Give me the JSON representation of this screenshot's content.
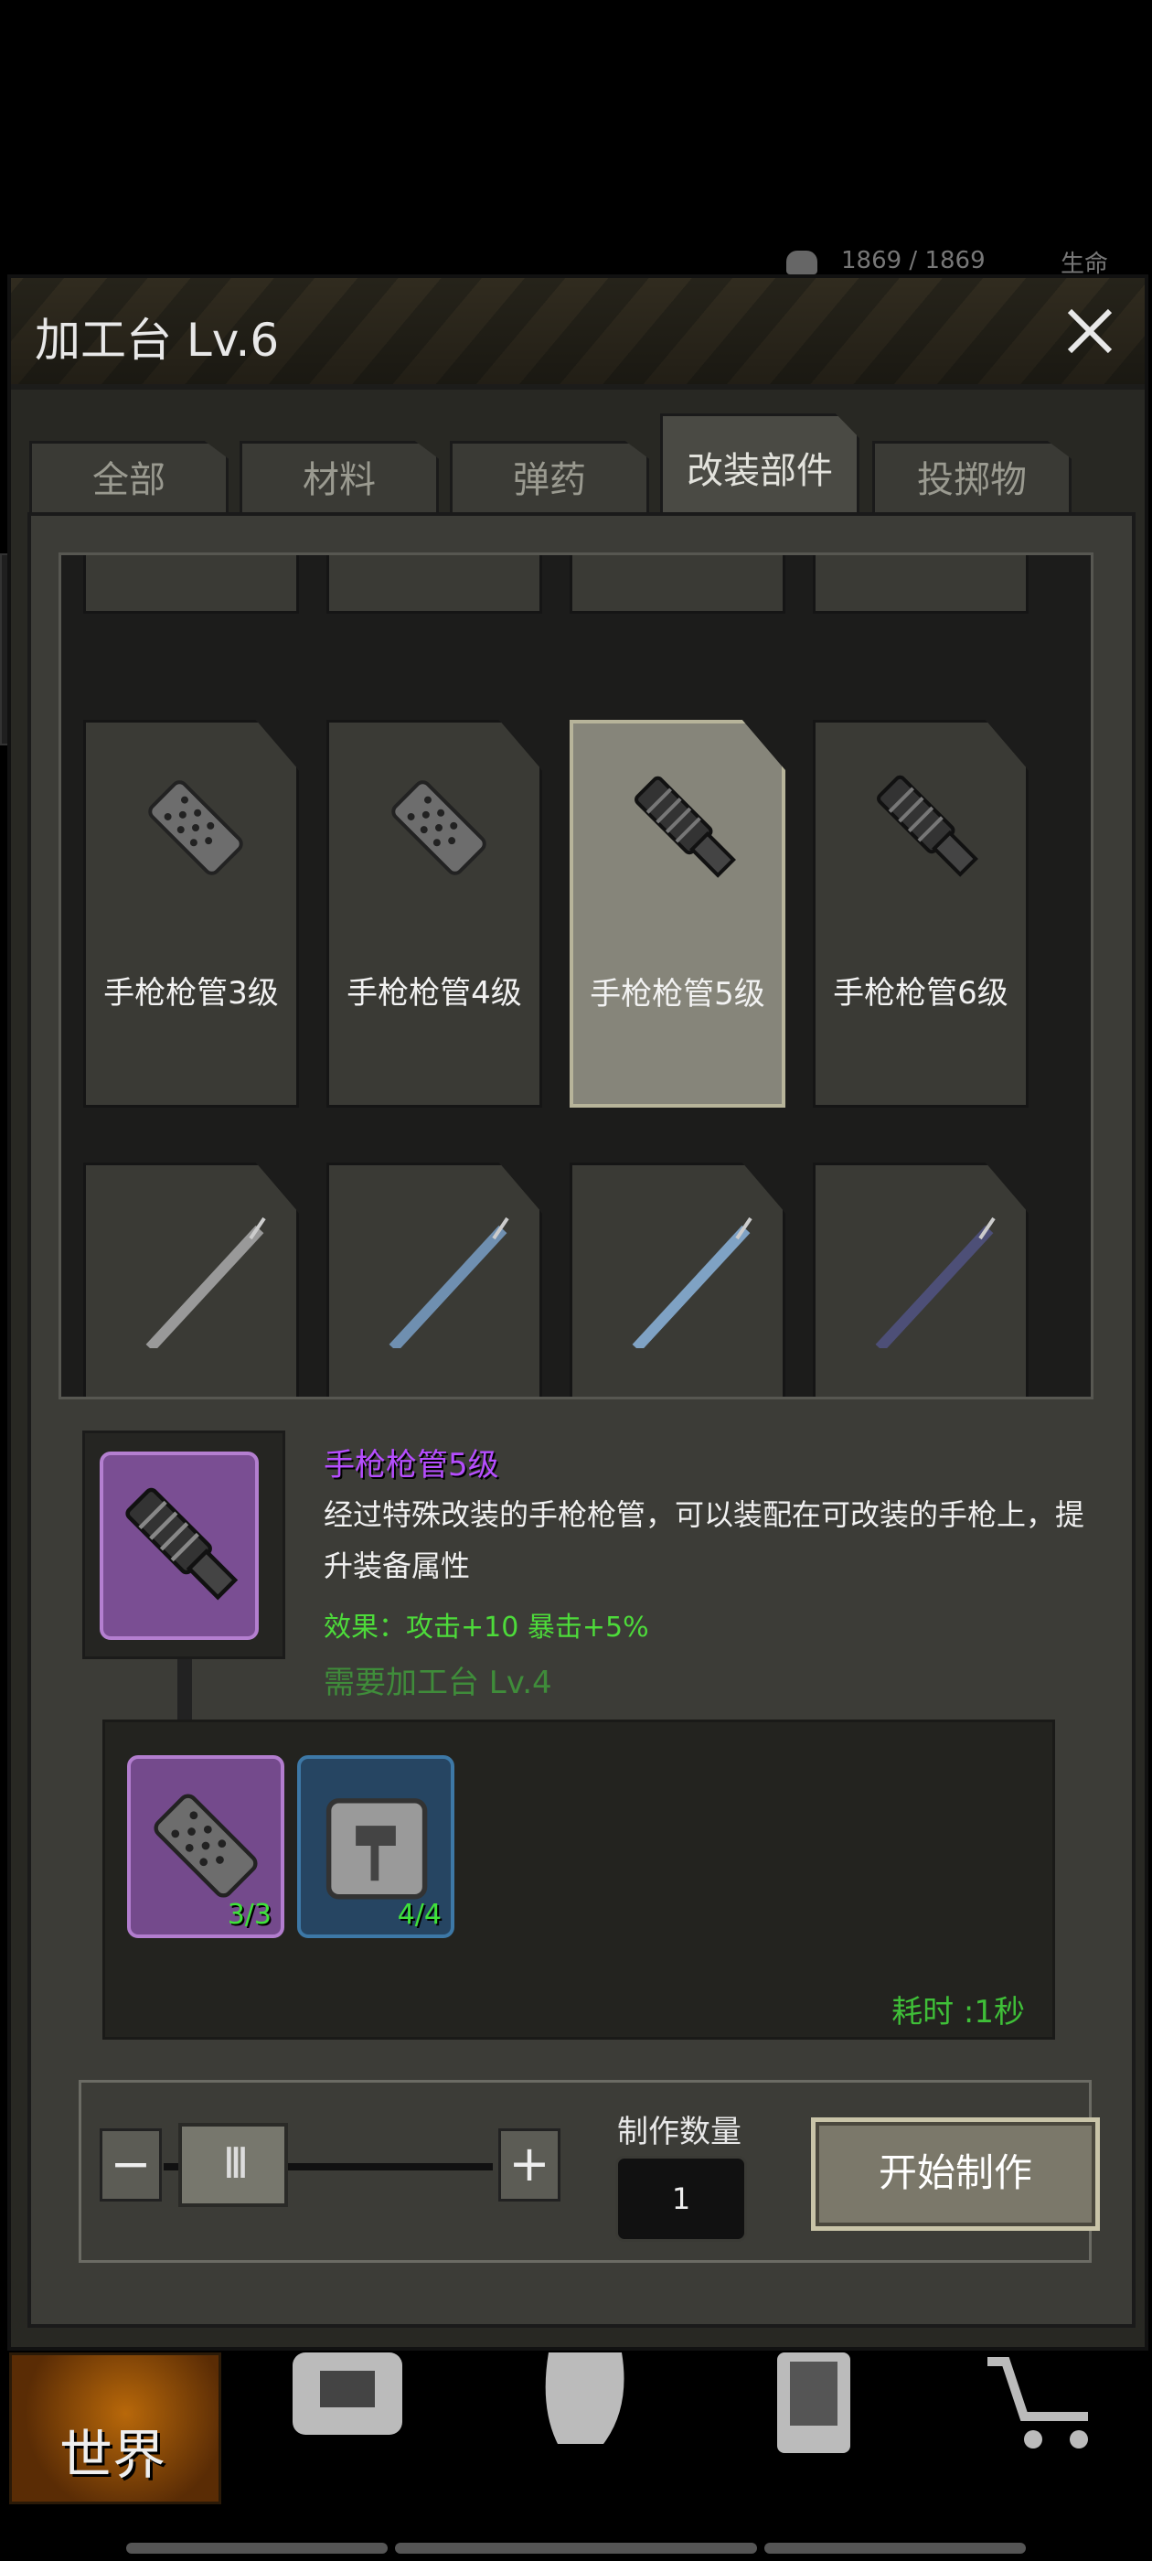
{
  "hud": {
    "hp_text": "1869 / 1869",
    "life_label": "生命"
  },
  "dialog": {
    "title": "加工台 Lv.6"
  },
  "tabs": [
    {
      "label": "全部",
      "active": false
    },
    {
      "label": "材料",
      "active": false
    },
    {
      "label": "弹药",
      "active": false
    },
    {
      "label": "改装部件",
      "active": true
    },
    {
      "label": "投掷物",
      "active": false
    }
  ],
  "grid": {
    "items": [
      {
        "label": "手枪枪管3级",
        "icon": "silencer-icon",
        "selected": false
      },
      {
        "label": "手枪枪管4级",
        "icon": "silencer-icon",
        "selected": false
      },
      {
        "label": "手枪枪管5级",
        "icon": "barrel-icon",
        "selected": true
      },
      {
        "label": "手枪枪管6级",
        "icon": "barrel-icon",
        "selected": false
      }
    ],
    "partial_row_icons": [
      "rifle-barrel-icon",
      "rifle-barrel-icon",
      "rifle-barrel-icon",
      "rifle-barrel-icon"
    ]
  },
  "detail": {
    "name": "手枪枪管5级",
    "description": "经过特殊改装的手枪枪管，可以装配在可改装的手枪上，提升装备属性",
    "effect": "效果：攻击+10  暴击+5%",
    "requirement": "需要加工台 Lv.4",
    "materials": [
      {
        "icon": "silencer-icon",
        "count": "3/3",
        "rarity_color": "#744a8c"
      },
      {
        "icon": "axe-blade-icon",
        "count": "4/4",
        "rarity_color": "#264562"
      }
    ],
    "time_label": "耗时 :1秒"
  },
  "craft": {
    "quantity_label": "制作数量",
    "quantity_value": "1",
    "start_label": "开始制作",
    "slider_fraction": 0.0
  },
  "nav": {
    "world_label": "世界"
  },
  "colors": {
    "accent_purple": "#b64dff",
    "effect_green": "#4ddb3a",
    "selected_card": "#86857a"
  }
}
